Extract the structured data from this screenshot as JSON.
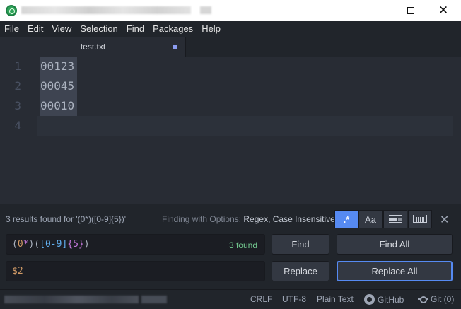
{
  "window": {
    "minimize_icon": "minimize-icon",
    "maximize_icon": "maximize-icon",
    "close_icon": "close-icon",
    "close_glyph": "✕"
  },
  "menu": [
    "File",
    "Edit",
    "View",
    "Selection",
    "Find",
    "Packages",
    "Help"
  ],
  "tab": {
    "title": "test.txt",
    "modified_indicator_color": "#8b9cf0"
  },
  "editor": {
    "line_numbers": [
      "1",
      "2",
      "3",
      "4"
    ],
    "lines": [
      "00123",
      "00045",
      "00010",
      ""
    ]
  },
  "find": {
    "status": "3 results found for '(0*)([0-9]{5})'",
    "options_prefix": "Finding with Options: ",
    "options_value": "Regex, Case Insensitive",
    "option_buttons": {
      "regex": ".*",
      "case": "Aa",
      "selection_icon": "in-selection-icon",
      "whole_word_icon": "whole-word-icon"
    },
    "close_glyph": "✕",
    "query_parts": [
      "(",
      "0",
      "*",
      ")(",
      "[0-9]",
      "{5}",
      ")"
    ],
    "found_count": "3 found",
    "replace_value": "$2",
    "buttons": {
      "find": "Find",
      "find_all": "Find All",
      "replace": "Replace",
      "replace_all": "Replace All"
    },
    "accent_color": "#568af2"
  },
  "status": {
    "line_ending": "CRLF",
    "encoding": "UTF-8",
    "grammar": "Plain Text",
    "github": "GitHub",
    "git": "Git (0)"
  }
}
